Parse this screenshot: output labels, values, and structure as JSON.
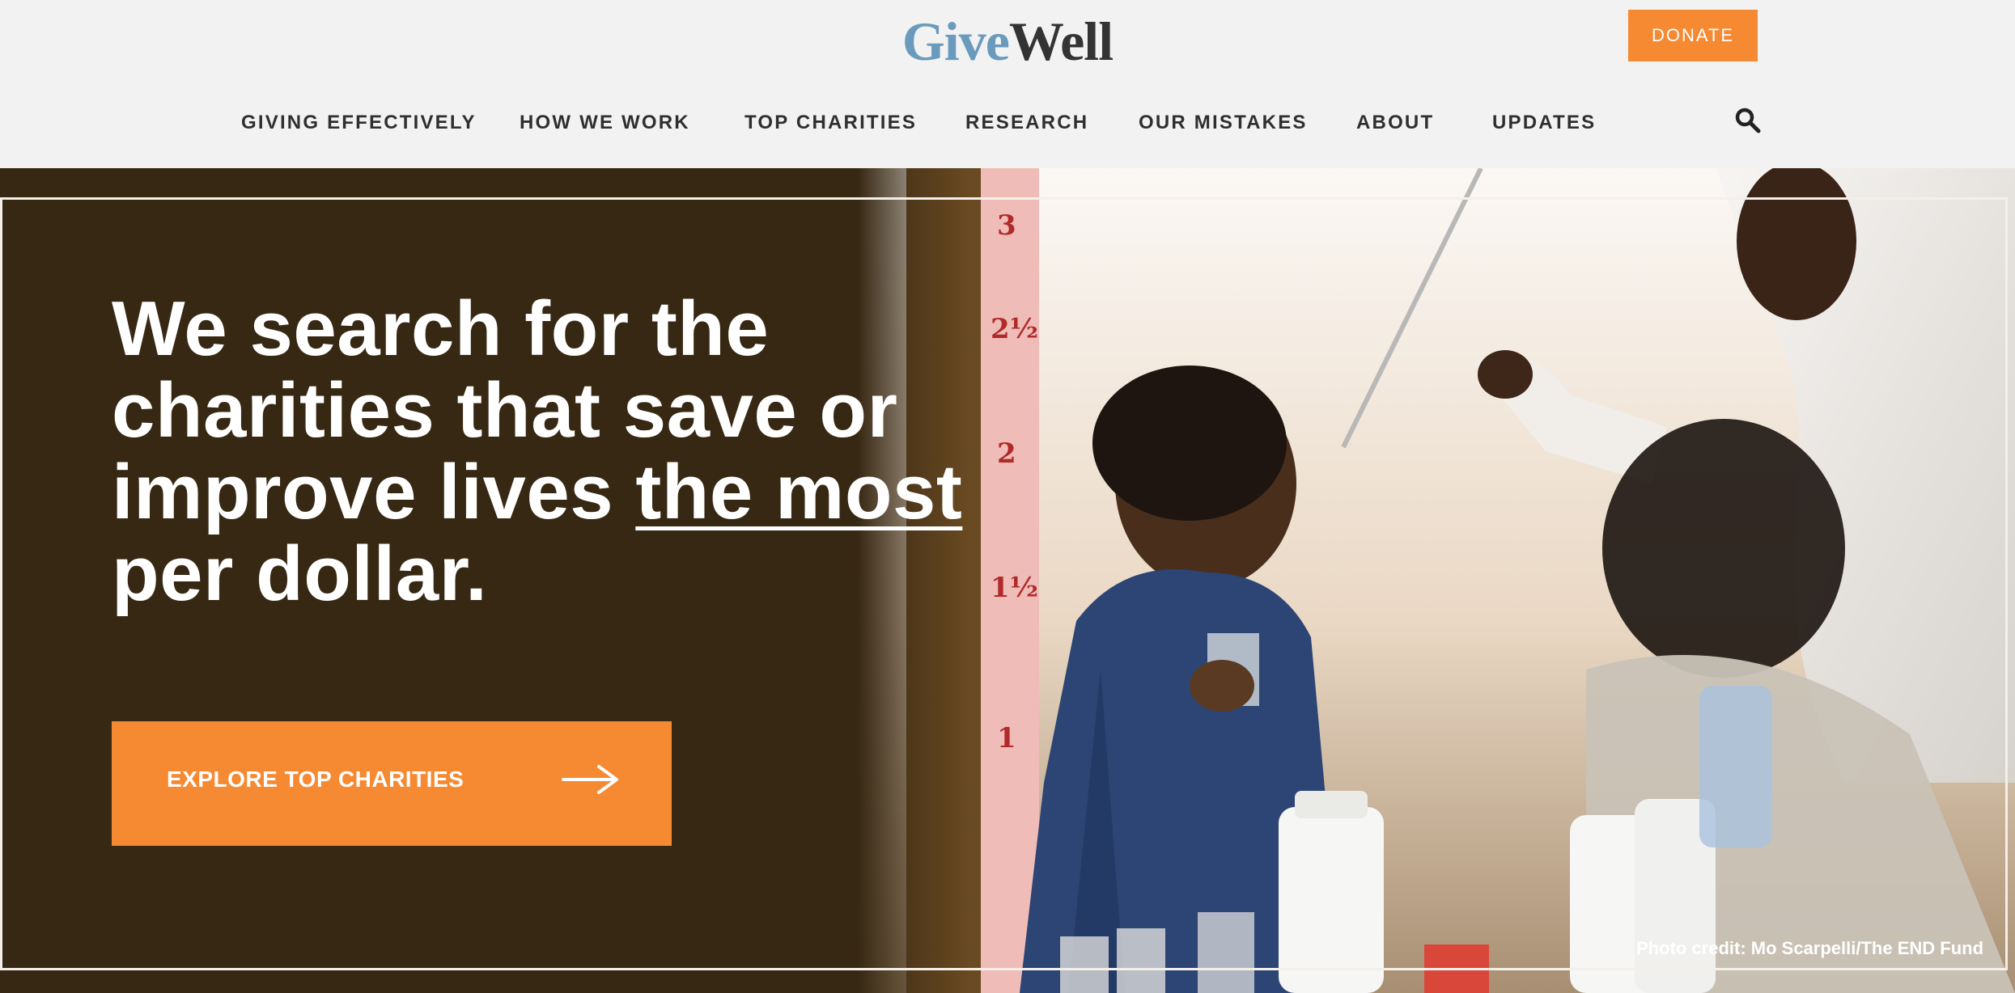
{
  "header": {
    "logo": {
      "give": "Give",
      "well": "Well"
    },
    "donate_label": "DONATE",
    "nav": [
      {
        "label": "GIVING EFFECTIVELY"
      },
      {
        "label": "HOW WE WORK"
      },
      {
        "label": "TOP CHARITIES"
      },
      {
        "label": "RESEARCH"
      },
      {
        "label": "OUR MISTAKES"
      },
      {
        "label": "ABOUT"
      },
      {
        "label": "UPDATES"
      }
    ],
    "search_icon": "search-icon"
  },
  "hero": {
    "headline": {
      "line1": "We search for the",
      "line2": "charities that save or",
      "line3_prefix": "improve lives ",
      "line3_emphasis": "the most",
      "line4": "per dollar."
    },
    "cta_label": "EXPLORE TOP CHARITIES",
    "cta_icon": "arrow-right-icon",
    "photo_credit": "Photo credit: Mo Scarpelli/The END Fund",
    "ruler_marks": [
      "3",
      "2½",
      "2",
      "1½",
      "1"
    ]
  },
  "colors": {
    "accent": "#f68a33",
    "hero_background": "#372813",
    "logo_give": "#6a9bbd",
    "logo_well": "#333333",
    "header_background": "#f2f2f2"
  }
}
